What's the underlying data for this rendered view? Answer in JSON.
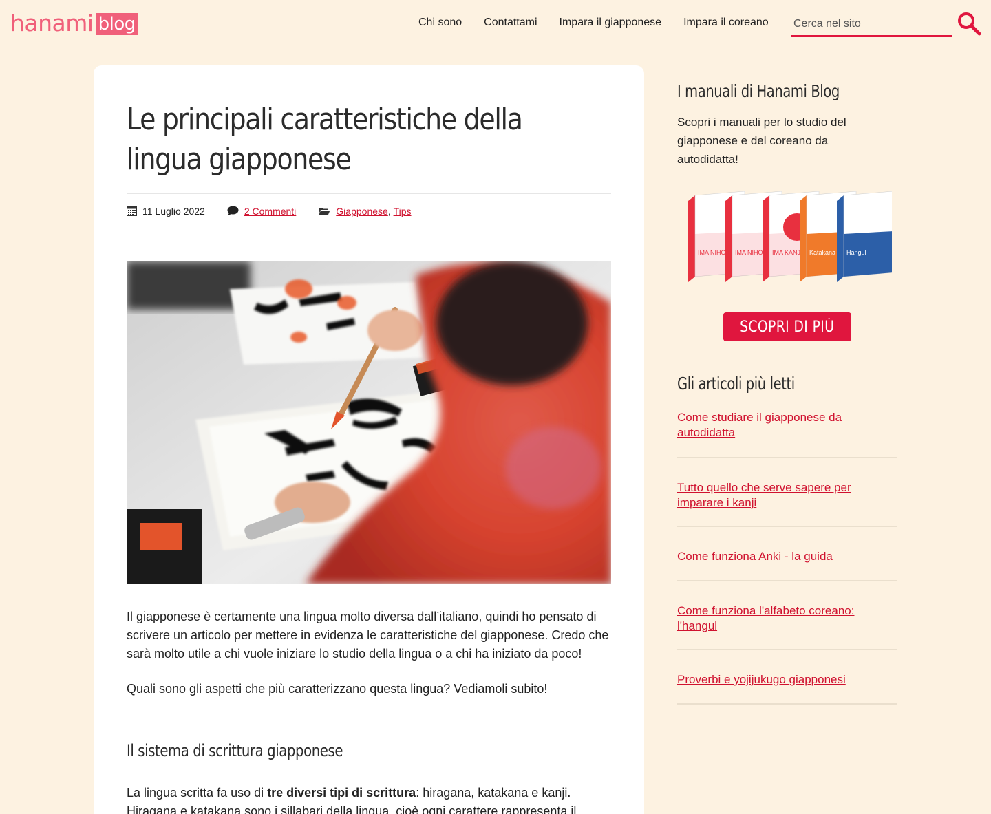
{
  "header": {
    "logo_word": "hanami",
    "logo_badge": "blog",
    "nav": [
      "Chi sono",
      "Contattami",
      "Impara il giapponese",
      "Impara il coreano"
    ],
    "search_placeholder": "Cerca nel sito"
  },
  "article": {
    "title": "Le principali caratteristiche della lingua giapponese",
    "date": "11 Luglio 2022",
    "comments": "2 Commenti",
    "categories": [
      "Giapponese",
      "Tips"
    ],
    "category_sep": ",",
    "p1": "Il giapponese è certamente una lingua molto diversa dall’italiano, quindi ho pensato di scrivere un articolo per mettere in evidenza le caratteristiche del giapponese. Credo che sarà molto utile a chi vuole iniziare lo studio della lingua o a chi ha iniziato da poco!",
    "p2": "Quali sono gli aspetti che più caratterizzano questa lingua? Vediamoli subito!",
    "h2": "Il sistema di scrittura giapponese",
    "p3_before": "La lingua scritta fa uso di ",
    "p3_bold": "tre diversi tipi di scrittura",
    "p3_after": ": hiragana, katakana e kanji. Hiragana e katakana sono i sillabari della lingua, cioè ogni carattere rappresenta il"
  },
  "sidebar": {
    "manuals_heading": "I manuali di Hanami Blog",
    "manuals_desc": "Scopri i manuali per lo studio del giapponese e del coreano da autodidatta!",
    "books": [
      {
        "cover": "IMA NIHONGO",
        "color": "#e8303f"
      },
      {
        "cover": "IMA NIHONGO",
        "color": "#e8303f"
      },
      {
        "cover": "IMA KANJI",
        "color": "#e8303f"
      },
      {
        "cover": "Katakana",
        "color": "#f07a2a"
      },
      {
        "cover": "Hangul",
        "color": "#2c5fa8"
      }
    ],
    "cta_label": "SCOPRI DI PIÙ",
    "popular_heading": "Gli articoli più letti",
    "popular": [
      "Come studiare il giapponese da autodidatta",
      "Tutto quello che serve sapere per imparare i kanji",
      "Come funziona Anki - la guida",
      "Come funziona l'alfabeto coreano: l'hangul",
      "Proverbi e yojijukugo giapponesi"
    ]
  },
  "colors": {
    "accent": "#e0163e",
    "link": "#d0122f",
    "logo": "#f0607a",
    "background": "#fdf2e1"
  }
}
